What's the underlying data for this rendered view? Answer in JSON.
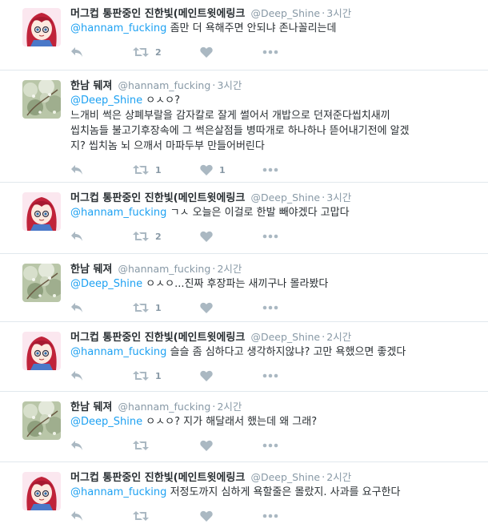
{
  "tweets": [
    {
      "user": "shine",
      "name": "머그컵 통판중인 진한빛(메인트윗에링크",
      "handle": "@Deep_Shine",
      "time": "3시간",
      "mention": "@hannam_fucking",
      "lines": [
        "좀만 더 욕해주면 안되냐 존나꼴리는데"
      ],
      "retweets": "2",
      "likes": ""
    },
    {
      "user": "hannam",
      "name": "한남 뒈져",
      "handle": "@hannam_fucking",
      "time": "3시간",
      "mention": "@Deep_Shine",
      "lines": [
        "ㅇㅅㅇ?",
        "느개비 썩은 상폐부랄을 감자칼로 잘게 썰어서 개밥으로 던져준다씹치새끼",
        "씹치놈들 불고기후장속에 그 썩은살점들 병따개로 하나하나 뜯어내기전에 알겠",
        "지? 씹치놈 뇌 으깨서 마파두부 만들어버린다"
      ],
      "retweets": "1",
      "likes": "1"
    },
    {
      "user": "shine",
      "name": "머그컵 통판중인 진한빛(메인트윗에링크",
      "handle": "@Deep_Shine",
      "time": "3시간",
      "mention": "@hannam_fucking",
      "lines": [
        "ㄱㅅ 오늘은 이걸로 한발 빼야겠다 고맙다"
      ],
      "retweets": "2",
      "likes": ""
    },
    {
      "user": "hannam",
      "name": "한남 뒈져",
      "handle": "@hannam_fucking",
      "time": "2시간",
      "mention": "@Deep_Shine",
      "lines": [
        "ㅇㅅㅇ...진짜 후장파는 새끼구나 몰라봤다"
      ],
      "retweets": "1",
      "likes": ""
    },
    {
      "user": "shine",
      "name": "머그컵 통판중인 진한빛(메인트윗에링크",
      "handle": "@Deep_Shine",
      "time": "2시간",
      "mention": "@hannam_fucking",
      "lines": [
        "슬슬 좀 심하다고 생각하지않냐? 고만 욕했으면 좋겠다"
      ],
      "retweets": "1",
      "likes": ""
    },
    {
      "user": "hannam",
      "name": "한남 뒈져",
      "handle": "@hannam_fucking",
      "time": "2시간",
      "mention": "@Deep_Shine",
      "lines": [
        "ㅇㅅㅇ? 지가 해달래서 했는데 왜 그래?"
      ],
      "retweets": "",
      "likes": ""
    },
    {
      "user": "shine",
      "name": "머그컵 통판중인 진한빛(메인트윗에링크",
      "handle": "@Deep_Shine",
      "time": "2시간",
      "mention": "@hannam_fucking",
      "lines": [
        "저정도까지 심하게 욕할줄은 몰랐지. 사과를 요구한다"
      ],
      "retweets": "",
      "likes": ""
    }
  ],
  "icons": {
    "reply": "reply-icon",
    "retweet": "retweet-icon",
    "like": "heart-icon",
    "more": "more-icon"
  },
  "colors": {
    "mention": "#1da1f2",
    "meta": "#8899a6",
    "icon": "#aab8c2",
    "border": "#e1e8ed"
  }
}
